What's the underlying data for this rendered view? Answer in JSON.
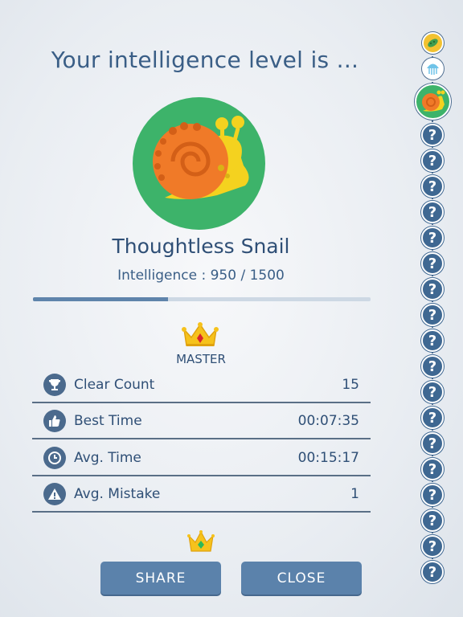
{
  "result": {
    "heading": "Your intelligence level is ...",
    "creature_name": "Thoughtless Snail",
    "intelligence_text": "Intelligence : 950 / 1500",
    "intelligence_progress": 0.4,
    "rank": "MASTER"
  },
  "stats": [
    {
      "icon": "trophy-icon",
      "label": "Clear Count",
      "value": "15"
    },
    {
      "icon": "thumbs-up-icon",
      "label": "Best Time",
      "value": "00:07:35"
    },
    {
      "icon": "clock-icon",
      "label": "Avg. Time",
      "value": "00:15:17"
    },
    {
      "icon": "warning-icon",
      "label": "Avg. Mistake",
      "value": "1"
    }
  ],
  "buttons": {
    "share": "SHARE",
    "close": "CLOSE"
  },
  "level_track": {
    "unlocked": [
      "bacteria-icon",
      "jellyfish-icon",
      "snail-icon"
    ],
    "locked_symbol": "?",
    "locked_count": 18
  },
  "colors": {
    "accent": "#5b82ab",
    "avatar_bg": "#3db36a",
    "text": "#2f4f76"
  }
}
